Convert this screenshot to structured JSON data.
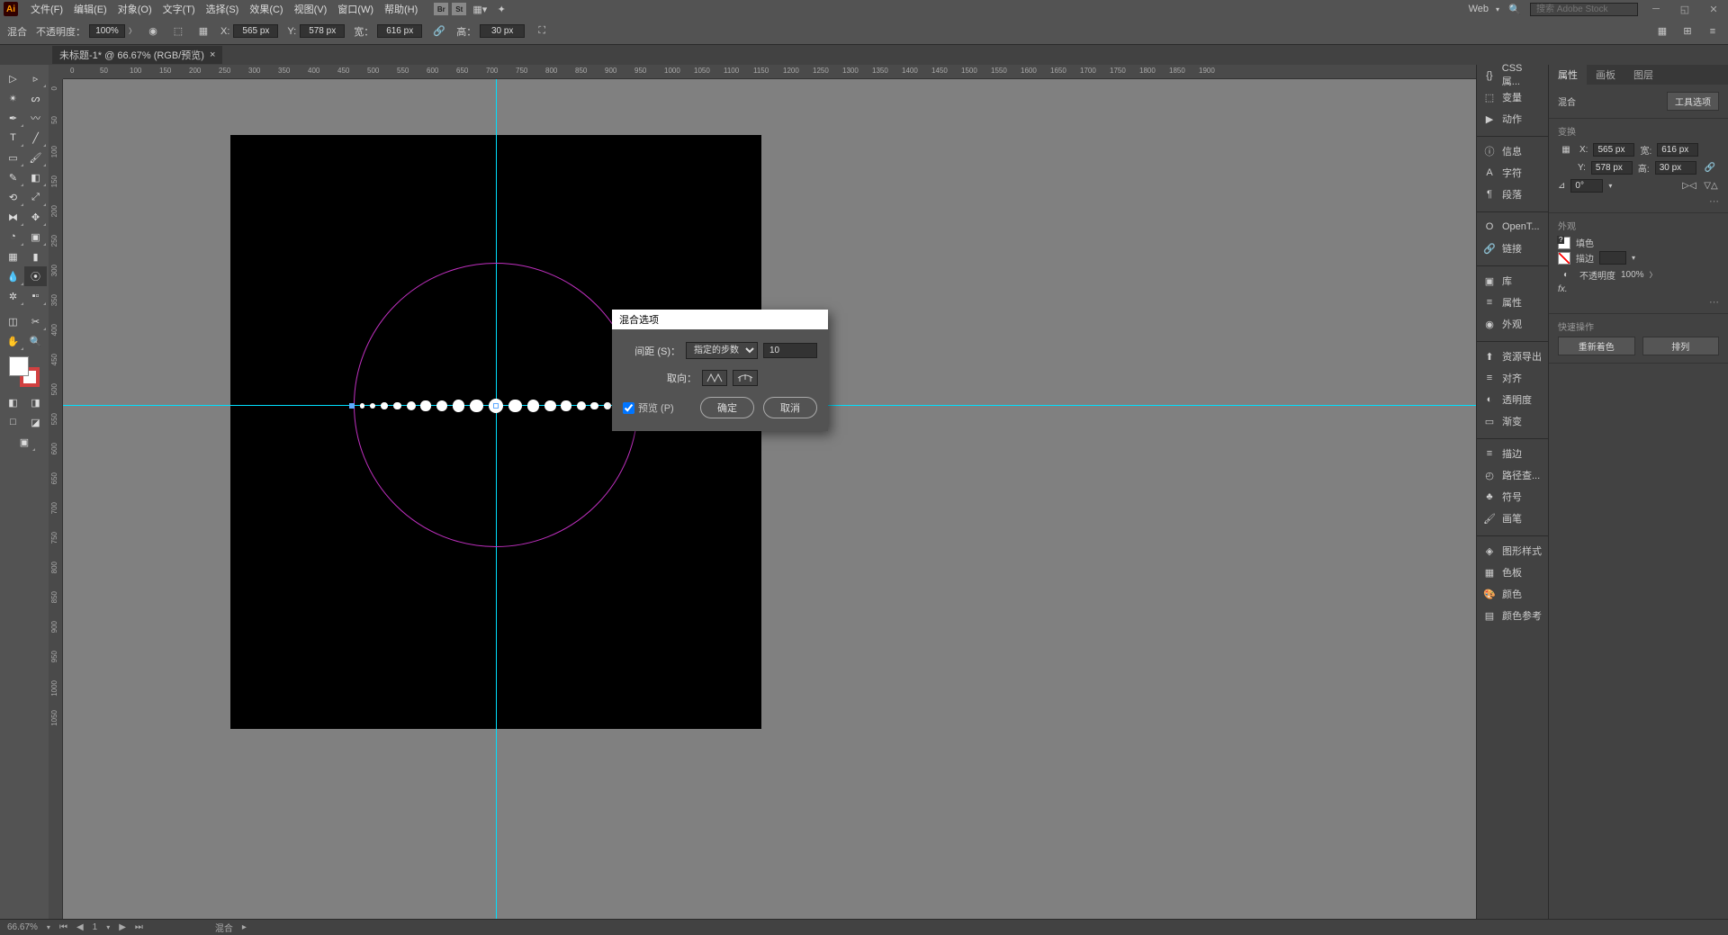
{
  "app": {
    "icon": "Ai"
  },
  "menu": [
    "文件(F)",
    "编辑(E)",
    "对象(O)",
    "文字(T)",
    "选择(S)",
    "效果(C)",
    "视图(V)",
    "窗口(W)",
    "帮助(H)"
  ],
  "titlebar": {
    "workspace": "Web",
    "search_placeholder": "搜索 Adobe Stock"
  },
  "control": {
    "blend_label": "混合",
    "opacity_label": "不透明度：",
    "opacity_value": "100%",
    "x_label": "X:",
    "x_value": "565 px",
    "y_label": "Y:",
    "y_value": "578 px",
    "w_label": "宽：",
    "w_value": "616 px",
    "h_label": "高：",
    "h_value": "30 px"
  },
  "doc_tab": {
    "title": "未标题-1* @ 66.67% (RGB/预览)"
  },
  "ruler_marks_h": [
    "0",
    "50",
    "100",
    "150",
    "200",
    "250",
    "300",
    "350",
    "400",
    "450",
    "500",
    "550",
    "600",
    "650",
    "700",
    "750",
    "800",
    "850",
    "900",
    "950",
    "1000",
    "1050",
    "1100",
    "1150",
    "1200",
    "1250",
    "1300",
    "1350",
    "1400",
    "1450",
    "1500",
    "1550",
    "1600",
    "1650",
    "1700",
    "1750",
    "1800",
    "1850",
    "1900"
  ],
  "ruler_marks_v": [
    "0",
    "50",
    "100",
    "150",
    "200",
    "250",
    "300",
    "350",
    "400",
    "450",
    "500",
    "550",
    "600",
    "650",
    "700",
    "750",
    "800",
    "850",
    "900",
    "950",
    "1000",
    "1050"
  ],
  "right_panels": [
    "CSS 属...",
    "变量",
    "动作",
    "信息",
    "字符",
    "段落",
    "OpenT...",
    "链接",
    "库",
    "属性",
    "外观",
    "资源导出",
    "对齐",
    "透明度",
    "渐变",
    "描边",
    "路径查...",
    "符号",
    "画笔",
    "图形样式",
    "色板",
    "颜色",
    "颜色参考"
  ],
  "properties": {
    "tabs": [
      "属性",
      "画板",
      "图层"
    ],
    "type_label": "混合",
    "tool_options": "工具选项",
    "transform_label": "变换",
    "x": "565 px",
    "y": "578 px",
    "w": "616 px",
    "h": "30 px",
    "angle": "0°",
    "appearance_label": "外观",
    "fill_label": "填色",
    "stroke_label": "描边",
    "opacity_label": "不透明度",
    "opacity_val": "100%",
    "quick_actions_label": "快速操作",
    "recolor": "重新着色",
    "arrange": "排列"
  },
  "dialog": {
    "title": "混合选项",
    "spacing_label": "间距 (S)：",
    "spacing_mode": "指定的步数",
    "spacing_value": "10",
    "orient_label": "取向：",
    "preview_label": "预览 (P)",
    "ok": "确定",
    "cancel": "取消"
  },
  "status": {
    "zoom": "66.67%",
    "tool": "混合"
  }
}
